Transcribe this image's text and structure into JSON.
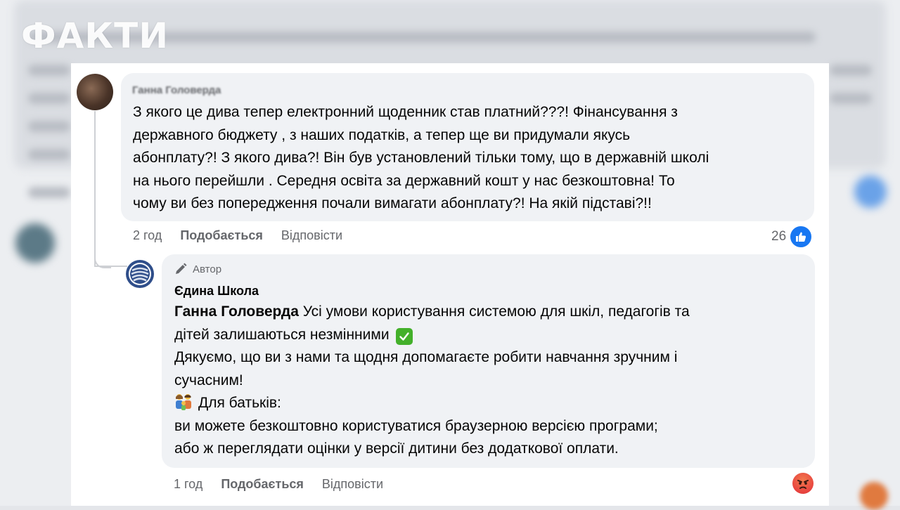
{
  "watermark": "ФАКТИ",
  "comment": {
    "author": "Ганна Головерда",
    "lines": [
      "З якого це дива тепер електронний щоденник став платний???! Фінансування з",
      "державного бюджету , з наших податків, а тепер ще ви придумали якусь",
      "абонплату?! З якого дива?! Він був установлений тільки тому, що в державній школі",
      "на нього перейшли . Середня освіта за державний кошт у нас безкоштовна! То",
      "чому ви без попередження почали вимагати абонплату?! На якій підставі?!!"
    ],
    "time": "2 год",
    "like_label": "Подобається",
    "reply_label": "Відповісти",
    "reaction_count": "26",
    "reaction_icon": "like-icon"
  },
  "reply": {
    "badge": "Автор",
    "badge_icon": "pencil-icon",
    "author": "Єдина Школа",
    "mention": "Ганна Головерда",
    "line1_rest": " Усі умови користування системою для шкіл, педагогів та",
    "line2": "дітей залишаються незмінними",
    "line2_emoji": "check-mark-icon",
    "line3": "Дякуємо, що ви з нами та щодня допомагаєте робити навчання зручним і",
    "line4": "сучасним!",
    "line5_emoji": "family-icon",
    "line5": "Для батьків:",
    "line6": "ви можете безкоштовно користуватися браузерною версією програми;",
    "line7": "або ж переглядати оцінки у версії дитини без додаткової оплати.",
    "time": "1 год",
    "like_label": "Подобається",
    "reply_label": "Відповісти",
    "reaction_icon": "angry-icon"
  },
  "colors": {
    "accent": "#1877f2",
    "bubble": "#f0f2f5",
    "text": "#050505",
    "muted": "#65676b"
  }
}
